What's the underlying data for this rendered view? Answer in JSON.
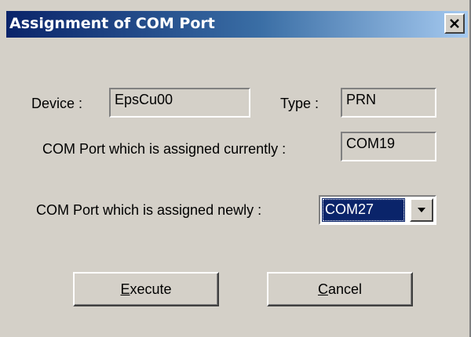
{
  "window": {
    "title": "Assignment of COM Port",
    "close_icon": "close-icon"
  },
  "device": {
    "label": "Device :",
    "value": "EpsCu00"
  },
  "type": {
    "label": "Type :",
    "value": "PRN"
  },
  "current_port": {
    "label": "COM Port which is assigned currently :",
    "value": "COM19"
  },
  "new_port": {
    "label": "COM Port which is assigned newly :",
    "selected": "COM27",
    "dropdown_icon": "chevron-down-icon"
  },
  "buttons": {
    "execute": {
      "accel": "E",
      "rest": "xecute"
    },
    "cancel": {
      "accel": "C",
      "rest": "ancel"
    }
  },
  "colors": {
    "face": "#d4d0c8",
    "title_start": "#0a246a",
    "title_end": "#a6caf0",
    "selection": "#0a246a"
  }
}
